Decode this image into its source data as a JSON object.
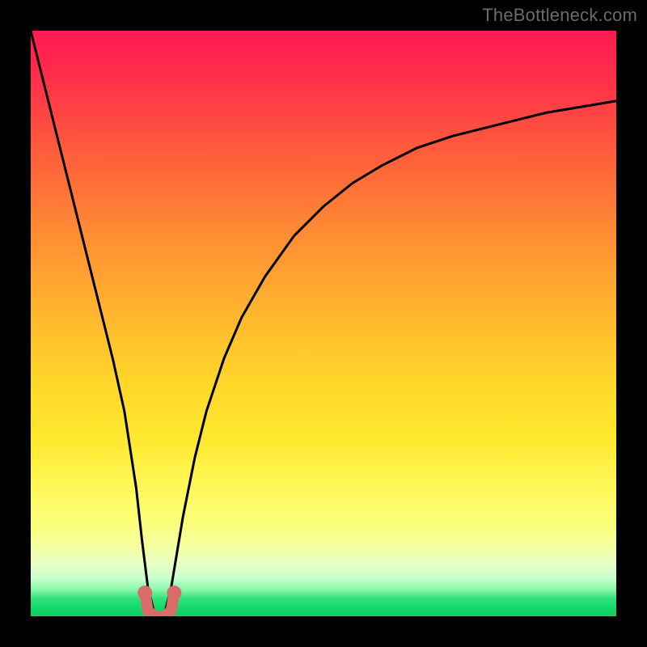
{
  "watermark": {
    "text": "TheBottleneck.com"
  },
  "colors": {
    "frame": "#000000",
    "curve": "#000000",
    "marker": "#d96b6b",
    "gradient_top": "#ff1a52",
    "gradient_mid": "#ffe92e",
    "gradient_bottom": "#0fce62"
  },
  "chart_data": {
    "type": "line",
    "title": "",
    "xlabel": "",
    "ylabel": "",
    "xlim": [
      0,
      100
    ],
    "ylim": [
      0,
      100
    ],
    "grid": false,
    "legend": false,
    "notch_x": 22,
    "notch_width": 6,
    "series": [
      {
        "name": "bottleneck-curve",
        "x": [
          0,
          2,
          4,
          6,
          8,
          10,
          12,
          14,
          16,
          18,
          19,
          20,
          21,
          22,
          23,
          24,
          25,
          26,
          28,
          30,
          33,
          36,
          40,
          45,
          50,
          55,
          60,
          66,
          72,
          80,
          88,
          94,
          100
        ],
        "y": [
          100,
          92,
          84,
          76,
          68,
          60,
          52,
          44,
          35,
          22,
          13,
          5,
          1,
          0,
          1,
          5,
          11,
          17,
          27,
          35,
          44,
          51,
          58,
          65,
          70,
          74,
          77,
          80,
          82,
          84,
          86,
          87,
          88
        ]
      }
    ],
    "markers": [
      {
        "name": "notch-left",
        "x": 19.5,
        "y": 4
      },
      {
        "name": "notch-left-bottom",
        "x": 20.0,
        "y": 1
      },
      {
        "name": "notch-mid-left",
        "x": 21.0,
        "y": 0
      },
      {
        "name": "notch-mid-right",
        "x": 23.0,
        "y": 0
      },
      {
        "name": "notch-right-bottom",
        "x": 24.0,
        "y": 1
      },
      {
        "name": "notch-right",
        "x": 24.5,
        "y": 4
      }
    ]
  }
}
